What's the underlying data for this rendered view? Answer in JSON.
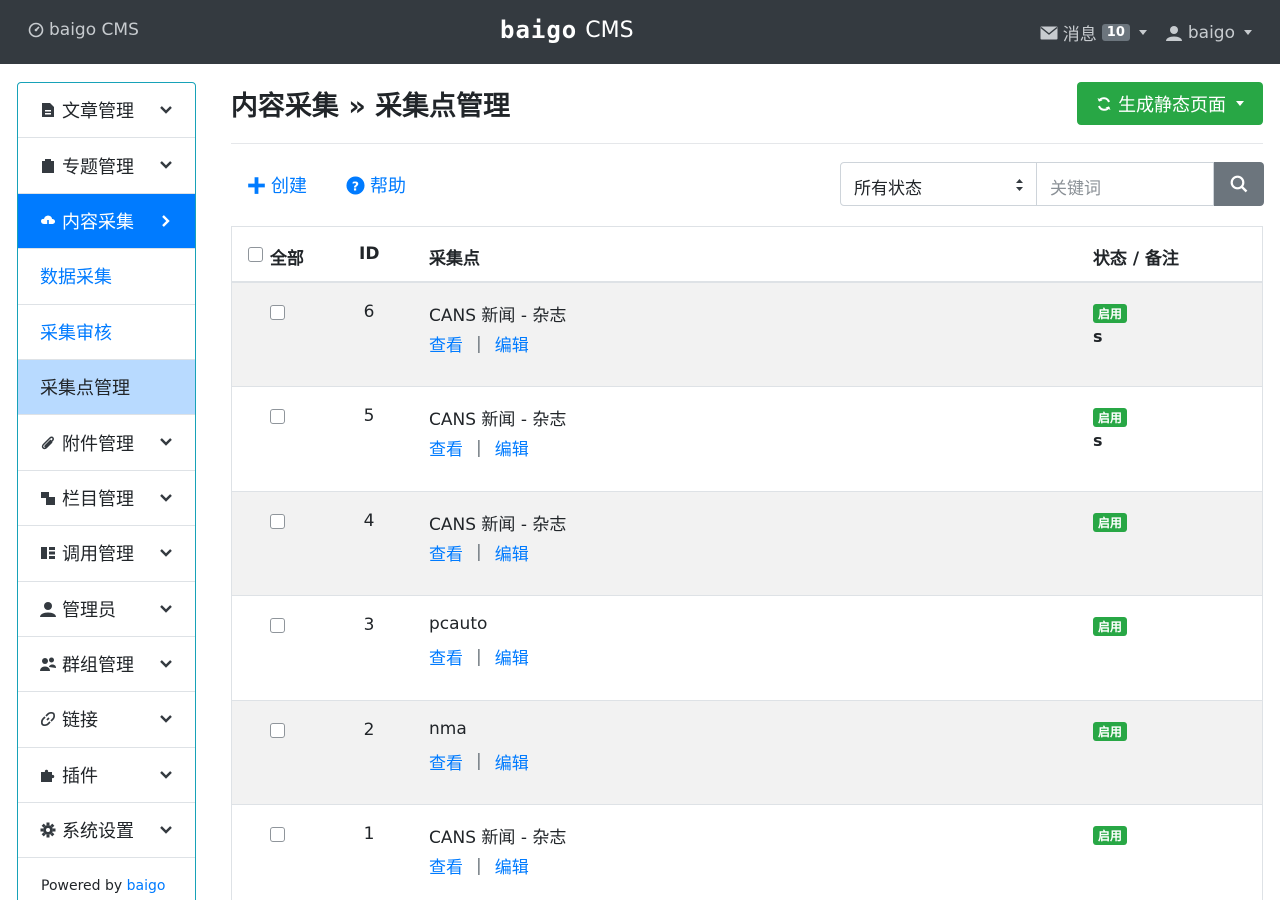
{
  "topbar": {
    "brand": "baigo CMS",
    "logo_word": "baigo",
    "logo_suffix": "CMS",
    "messages_label": "消息",
    "messages_count": "10",
    "user_label": "baigo"
  },
  "sidebar": {
    "items": [
      {
        "label": "文章管理",
        "icon": "file-icon"
      },
      {
        "label": "专题管理",
        "icon": "clipboard-icon"
      },
      {
        "label": "内容采集",
        "icon": "cloud-download-icon"
      },
      {
        "label": "数据采集"
      },
      {
        "label": "采集审核"
      },
      {
        "label": "采集点管理"
      },
      {
        "label": "附件管理",
        "icon": "paperclip-icon"
      },
      {
        "label": "栏目管理",
        "icon": "columns-icon"
      },
      {
        "label": "调用管理",
        "icon": "list-icon"
      },
      {
        "label": "管理员",
        "icon": "user-icon"
      },
      {
        "label": "群组管理",
        "icon": "users-icon"
      },
      {
        "label": "链接",
        "icon": "link-icon"
      },
      {
        "label": "插件",
        "icon": "puzzle-icon"
      },
      {
        "label": "系统设置",
        "icon": "gear-icon"
      }
    ],
    "footer_prefix": "Powered by",
    "footer_link": "baigo"
  },
  "page": {
    "title": "内容采集 » 采集点管理",
    "generate_button": "生成静态页面"
  },
  "actions": {
    "create": "创建",
    "help": "帮助"
  },
  "filter": {
    "status_selected": "所有状态",
    "keyword_placeholder": "关键词"
  },
  "table": {
    "headers": {
      "all": "全部",
      "id": "ID",
      "point": "采集点",
      "status": "状态 / 备注"
    },
    "view_label": "查看",
    "sep": "|",
    "edit_label": "编辑",
    "rows": [
      {
        "id": "6",
        "name": "CANS 新闻 - 杂志",
        "status": "启用",
        "note": "s"
      },
      {
        "id": "5",
        "name": "CANS 新闻 - 杂志",
        "status": "启用",
        "note": "s"
      },
      {
        "id": "4",
        "name": "CANS 新闻 - 杂志",
        "status": "启用",
        "note": ""
      },
      {
        "id": "3",
        "name": "pcauto",
        "status": "启用",
        "note": ""
      },
      {
        "id": "2",
        "name": "nma",
        "status": "启用",
        "note": ""
      },
      {
        "id": "1",
        "name": "CANS 新闻 - 杂志",
        "status": "启用",
        "note": ""
      }
    ]
  },
  "colors": {
    "topbar": "#343a40",
    "primary": "#007bff",
    "success": "#28a745",
    "secondary": "#6c757d",
    "selected_bg": "#b8daff"
  }
}
